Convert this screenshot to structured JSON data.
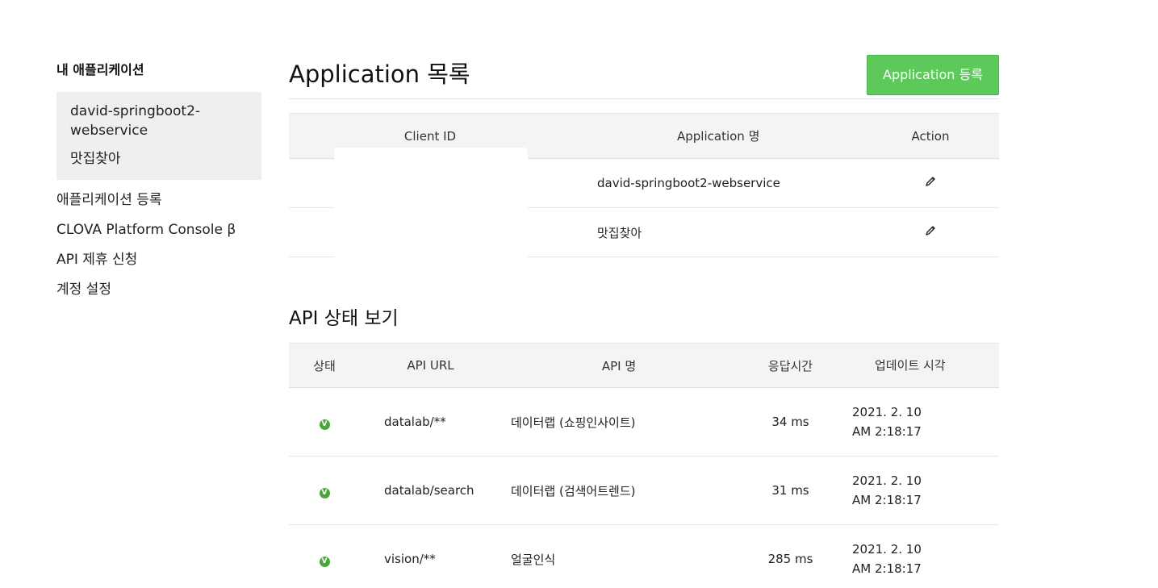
{
  "sidebar": {
    "title": "내 애플리케이션",
    "apps": [
      "david-springboot2-webservice",
      "맛집찾아"
    ],
    "links": [
      "애플리케이션 등록",
      "CLOVA Platform Console β",
      "API 제휴 신청",
      "계정 설정"
    ]
  },
  "main": {
    "title": "Application 목록",
    "register_button": "Application 등록",
    "app_table": {
      "headers": [
        "Client ID",
        "Application 명",
        "Action"
      ],
      "rows": [
        {
          "client_id": "",
          "name": "david-springboot2-webservice",
          "action_icon": "pencil-icon"
        },
        {
          "client_id": "",
          "name": "맛집찾아",
          "action_icon": "pencil-icon"
        }
      ]
    },
    "api_section_title": "API 상태 보기",
    "api_table": {
      "headers": [
        "상태",
        "API URL",
        "API 명",
        "응답시간",
        "업데이트 시각"
      ],
      "rows": [
        {
          "status": "V",
          "url": "datalab/**",
          "name": "데이터랩 (쇼핑인사이트)",
          "response": "34 ms",
          "date": "2021. 2. 10",
          "time": "AM 2:18:17"
        },
        {
          "status": "V",
          "url": "datalab/search",
          "name": "데이터랩 (검색어트렌드)",
          "response": "31 ms",
          "date": "2021. 2. 10",
          "time": "AM 2:18:17"
        },
        {
          "status": "V",
          "url": "vision/**",
          "name": "얼굴인식",
          "response": "285 ms",
          "date": "2021. 2. 10",
          "time": "AM 2:18:17"
        }
      ]
    }
  },
  "colors": {
    "accent": "#5dc95a",
    "status_ok": "#4aa53b",
    "header_bg": "#f4f4f4",
    "sidebar_box": "#efefef"
  }
}
